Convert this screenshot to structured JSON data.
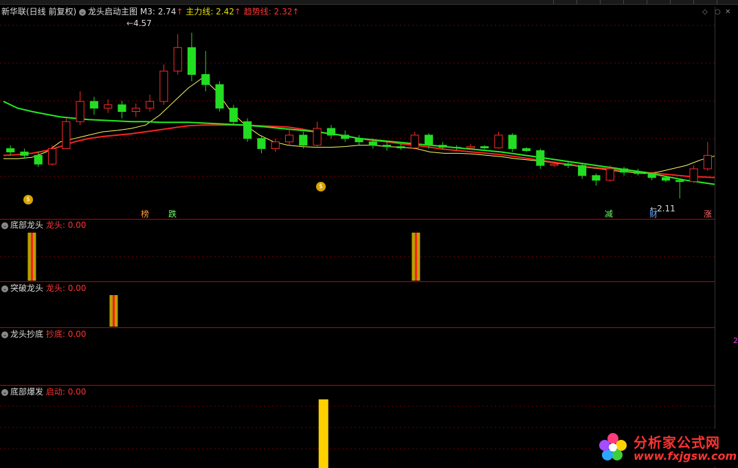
{
  "header": {
    "stock_name": "新华联(日线 前复权)",
    "indicator_name": "龙头启动主图",
    "m3_label": "M3: 2.74",
    "main_label": "主力线: 2.42",
    "trend_label": "趋势线: 2.32",
    "up_arrow": "↑"
  },
  "annotations": {
    "high_price": "4.57",
    "low_price": "2.11",
    "signals": [
      "榜",
      "跌",
      "减",
      "财",
      "涨"
    ]
  },
  "panels": [
    {
      "title": "底部龙头",
      "label": "龙头: 0.00"
    },
    {
      "title": "突破龙头",
      "label": "龙头: 0.00"
    },
    {
      "title": "龙头抄底",
      "label": "抄底: 0.00"
    },
    {
      "title": "底部爆发",
      "label": "启动: 0.00"
    }
  ],
  "side_marker": "2",
  "watermark": {
    "name": "分析家公式网",
    "url": "www.fxjgsw.com"
  },
  "colors": {
    "up": "#ff2a2a",
    "down": "#22dd22",
    "m3": "#ffff66",
    "main": "#ff2222",
    "trend": "#22ee22",
    "signal_yellow": "#ffd000"
  },
  "chart_data": {
    "type": "candlestick",
    "series": [
      {
        "name": "M3",
        "values": [
          2.7,
          2.7,
          2.72,
          2.8,
          2.95,
          3.0,
          3.05,
          3.1,
          3.12,
          3.15,
          3.2,
          3.35,
          3.55,
          3.75,
          3.9,
          3.7,
          3.4,
          3.2,
          3.05,
          2.95,
          2.9,
          2.88,
          2.87,
          2.87,
          2.88,
          2.9,
          2.9,
          2.88,
          2.87,
          2.85,
          2.8,
          2.78,
          2.78,
          2.77,
          2.75,
          2.73,
          2.7,
          2.68,
          2.66,
          2.63,
          2.6,
          2.57,
          2.55,
          2.52,
          2.5,
          2.48,
          2.5,
          2.55,
          2.6,
          2.68,
          2.74
        ]
      },
      {
        "name": "主力线",
        "values": [
          2.75,
          2.76,
          2.78,
          2.82,
          2.88,
          2.95,
          3.0,
          3.03,
          3.05,
          3.07,
          3.1,
          3.13,
          3.16,
          3.19,
          3.2,
          3.2,
          3.2,
          3.2,
          3.19,
          3.18,
          3.17,
          3.14,
          3.1,
          3.07,
          3.04,
          3.0,
          2.97,
          2.95,
          2.92,
          2.9,
          2.87,
          2.84,
          2.82,
          2.8,
          2.78,
          2.76,
          2.73,
          2.7,
          2.67,
          2.64,
          2.61,
          2.58,
          2.56,
          2.54,
          2.52,
          2.5,
          2.48,
          2.46,
          2.44,
          2.43,
          2.42
        ]
      },
      {
        "name": "趋势线",
        "values": [
          3.55,
          3.45,
          3.4,
          3.36,
          3.32,
          3.3,
          3.28,
          3.27,
          3.26,
          3.25,
          3.25,
          3.24,
          3.24,
          3.24,
          3.23,
          3.22,
          3.21,
          3.2,
          3.18,
          3.16,
          3.14,
          3.12,
          3.1,
          3.07,
          3.04,
          3.0,
          2.98,
          2.96,
          2.94,
          2.92,
          2.9,
          2.88,
          2.86,
          2.84,
          2.82,
          2.8,
          2.77,
          2.74,
          2.71,
          2.68,
          2.65,
          2.62,
          2.59,
          2.56,
          2.53,
          2.5,
          2.46,
          2.42,
          2.38,
          2.35,
          2.32
        ]
      }
    ],
    "candles": [
      {
        "o": 2.85,
        "c": 2.8,
        "h": 2.9,
        "l": 2.75
      },
      {
        "o": 2.8,
        "c": 2.75,
        "h": 2.85,
        "l": 2.7
      },
      {
        "o": 2.75,
        "c": 2.62,
        "h": 2.8,
        "l": 2.58
      },
      {
        "o": 2.62,
        "c": 2.85,
        "h": 2.9,
        "l": 2.6
      },
      {
        "o": 2.85,
        "c": 3.25,
        "h": 3.3,
        "l": 2.85
      },
      {
        "o": 3.25,
        "c": 3.55,
        "h": 3.7,
        "l": 3.2
      },
      {
        "o": 3.55,
        "c": 3.45,
        "h": 3.62,
        "l": 3.35
      },
      {
        "o": 3.45,
        "c": 3.5,
        "h": 3.58,
        "l": 3.38
      },
      {
        "o": 3.5,
        "c": 3.4,
        "h": 3.56,
        "l": 3.3
      },
      {
        "o": 3.4,
        "c": 3.45,
        "h": 3.52,
        "l": 3.32
      },
      {
        "o": 3.45,
        "c": 3.55,
        "h": 3.65,
        "l": 3.4
      },
      {
        "o": 3.55,
        "c": 4.0,
        "h": 4.1,
        "l": 3.5
      },
      {
        "o": 4.0,
        "c": 4.35,
        "h": 4.55,
        "l": 3.95
      },
      {
        "o": 4.35,
        "c": 3.95,
        "h": 4.57,
        "l": 3.85
      },
      {
        "o": 3.95,
        "c": 3.8,
        "h": 4.3,
        "l": 3.7
      },
      {
        "o": 3.8,
        "c": 3.45,
        "h": 3.85,
        "l": 3.4
      },
      {
        "o": 3.45,
        "c": 3.25,
        "h": 3.5,
        "l": 3.2
      },
      {
        "o": 3.25,
        "c": 3.0,
        "h": 3.3,
        "l": 2.95
      },
      {
        "o": 3.0,
        "c": 2.85,
        "h": 3.05,
        "l": 2.78
      },
      {
        "o": 2.85,
        "c": 2.95,
        "h": 3.0,
        "l": 2.8
      },
      {
        "o": 2.95,
        "c": 3.05,
        "h": 3.15,
        "l": 2.9
      },
      {
        "o": 3.05,
        "c": 2.9,
        "h": 3.1,
        "l": 2.85
      },
      {
        "o": 2.9,
        "c": 3.15,
        "h": 3.25,
        "l": 2.88
      },
      {
        "o": 3.15,
        "c": 3.05,
        "h": 3.2,
        "l": 3.0
      },
      {
        "o": 3.05,
        "c": 3.0,
        "h": 3.12,
        "l": 2.95
      },
      {
        "o": 3.0,
        "c": 2.95,
        "h": 3.05,
        "l": 2.9
      },
      {
        "o": 2.95,
        "c": 2.9,
        "h": 3.0,
        "l": 2.85
      },
      {
        "o": 2.9,
        "c": 2.88,
        "h": 2.95,
        "l": 2.82
      },
      {
        "o": 2.88,
        "c": 2.86,
        "h": 2.92,
        "l": 2.83
      },
      {
        "o": 2.86,
        "c": 3.05,
        "h": 3.1,
        "l": 2.84
      },
      {
        "o": 3.05,
        "c": 2.9,
        "h": 3.08,
        "l": 2.85
      },
      {
        "o": 2.9,
        "c": 2.87,
        "h": 2.95,
        "l": 2.84
      },
      {
        "o": 2.87,
        "c": 2.86,
        "h": 2.9,
        "l": 2.83
      },
      {
        "o": 2.86,
        "c": 2.88,
        "h": 2.92,
        "l": 2.84
      },
      {
        "o": 2.88,
        "c": 2.86,
        "h": 2.9,
        "l": 2.84
      },
      {
        "o": 2.86,
        "c": 3.05,
        "h": 3.1,
        "l": 2.85
      },
      {
        "o": 3.05,
        "c": 2.85,
        "h": 3.08,
        "l": 2.8
      },
      {
        "o": 2.85,
        "c": 2.82,
        "h": 2.87,
        "l": 2.8
      },
      {
        "o": 2.82,
        "c": 2.6,
        "h": 2.85,
        "l": 2.55
      },
      {
        "o": 2.6,
        "c": 2.62,
        "h": 2.65,
        "l": 2.58
      },
      {
        "o": 2.62,
        "c": 2.6,
        "h": 2.66,
        "l": 2.56
      },
      {
        "o": 2.6,
        "c": 2.45,
        "h": 2.62,
        "l": 2.4
      },
      {
        "o": 2.45,
        "c": 2.38,
        "h": 2.48,
        "l": 2.3
      },
      {
        "o": 2.38,
        "c": 2.55,
        "h": 2.6,
        "l": 2.36
      },
      {
        "o": 2.55,
        "c": 2.5,
        "h": 2.58,
        "l": 2.45
      },
      {
        "o": 2.5,
        "c": 2.48,
        "h": 2.55,
        "l": 2.45
      },
      {
        "o": 2.48,
        "c": 2.42,
        "h": 2.5,
        "l": 2.38
      },
      {
        "o": 2.42,
        "c": 2.38,
        "h": 2.45,
        "l": 2.35
      },
      {
        "o": 2.38,
        "c": 2.36,
        "h": 2.4,
        "l": 2.11
      },
      {
        "o": 2.36,
        "c": 2.55,
        "h": 2.6,
        "l": 2.34
      },
      {
        "o": 2.55,
        "c": 2.75,
        "h": 2.95,
        "l": 2.52
      }
    ],
    "ylim": [
      2.0,
      4.75
    ],
    "subpanels": [
      {
        "name": "底部龙头",
        "bars": [
          {
            "pos": 0.04,
            "value": 1
          },
          {
            "pos": 0.58,
            "value": 1
          }
        ]
      },
      {
        "name": "突破龙头",
        "bars": [
          {
            "pos": 0.155,
            "value": 1
          }
        ]
      },
      {
        "name": "龙头抄底",
        "bars": []
      },
      {
        "name": "底部爆发",
        "bars": [
          {
            "pos": 0.45,
            "value": 1
          }
        ]
      }
    ]
  }
}
